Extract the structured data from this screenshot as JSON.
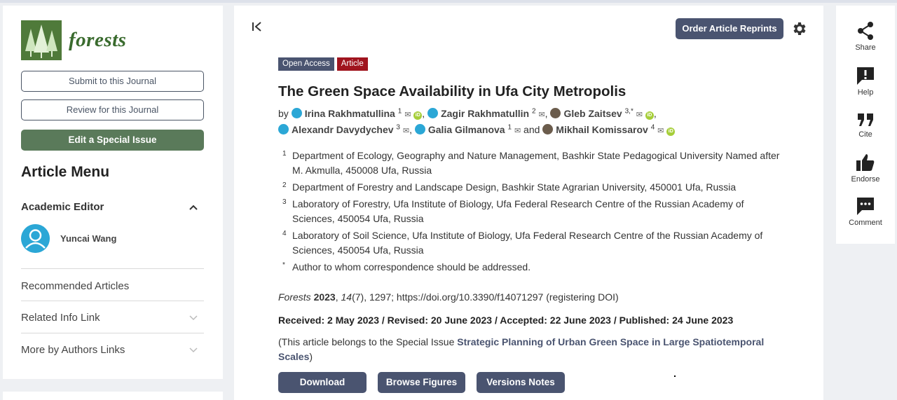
{
  "journal": {
    "name": "forests",
    "logo_icon": "forest-trees-logo"
  },
  "sidebar": {
    "submit_label": "Submit to this Journal",
    "review_label": "Review for this Journal",
    "edit_label": "Edit a Special Issue",
    "menu_title": "Article Menu",
    "academic_editor_label": "Academic Editor",
    "editor_name": "Yuncai Wang",
    "links": [
      {
        "label": "Recommended Articles"
      },
      {
        "label": "Related Info Link"
      },
      {
        "label": "More by Authors Links"
      }
    ]
  },
  "header": {
    "reprints_label": "Order Article Reprints",
    "collapse_icon": "collapse-left-icon",
    "settings_icon": "gear-icon"
  },
  "article": {
    "badge_open_access": "Open Access",
    "badge_type": "Article",
    "title": "The Green Space Availability in Ufa City Metropolis",
    "by": "by",
    "and": "and",
    "authors": [
      {
        "name": "Irina Rakhmatullina",
        "sup": "1"
      },
      {
        "name": "Zagir Rakhmatullin",
        "sup": "2"
      },
      {
        "name": "Gleb Zaitsev",
        "sup": "3,*"
      },
      {
        "name": "Alexandr Davydychev",
        "sup": "3"
      },
      {
        "name": "Galia Gilmanova",
        "sup": "1"
      },
      {
        "name": "Mikhail Komissarov",
        "sup": "4"
      }
    ],
    "affiliations": [
      {
        "num": "1",
        "text": "Department of Ecology, Geography and Nature Management, Bashkir State Pedagogical University Named after M. Akmulla, 450008 Ufa, Russia"
      },
      {
        "num": "2",
        "text": "Department of Forestry and Landscape Design, Bashkir State Agrarian University, 450001 Ufa, Russia"
      },
      {
        "num": "3",
        "text": "Laboratory of Forestry, Ufa Institute of Biology, Ufa Federal Research Centre of the Russian Academy of Sciences, 450054 Ufa, Russia"
      },
      {
        "num": "4",
        "text": "Laboratory of Soil Science, Ufa Institute of Biology, Ufa Federal Research Centre of the Russian Academy of Sciences, 450054 Ufa, Russia"
      },
      {
        "num": "*",
        "text": "Author to whom correspondence should be addressed."
      }
    ],
    "citation": {
      "journal": "Forests",
      "year": "2023",
      "volume": "14",
      "rest": "(7), 1297; https://doi.org/10.3390/f14071297 (registering DOI)"
    },
    "dates": "Received: 2 May 2023 / Revised: 20 June 2023 / Accepted: 22 June 2023 / Published: 24 June 2023",
    "special_prefix": "(This article belongs to the Special Issue ",
    "special_link": "Strategic Planning of Urban Green Space in Large Spatiotemporal Scales",
    "special_suffix": ")"
  },
  "actions": {
    "download": "Download",
    "figures": "Browse Figures",
    "versions": "Versions Notes"
  },
  "toolbar": [
    {
      "label": "Share",
      "icon": "share-icon"
    },
    {
      "label": "Help",
      "icon": "help-icon"
    },
    {
      "label": "Cite",
      "icon": "quote-icon"
    },
    {
      "label": "Endorse",
      "icon": "thumbs-up-icon"
    },
    {
      "label": "Comment",
      "icon": "comment-icon"
    }
  ]
}
